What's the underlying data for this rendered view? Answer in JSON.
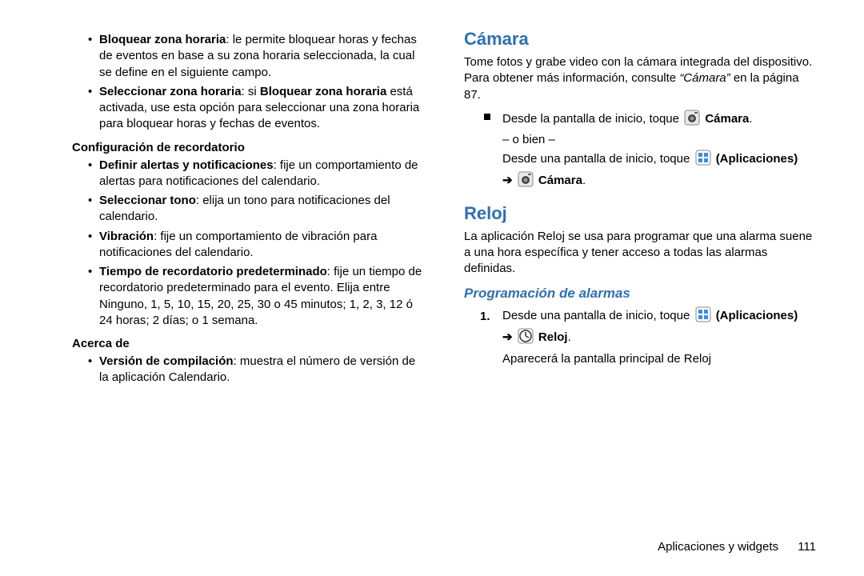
{
  "left": {
    "b1_label": "Bloquear zona horaria",
    "b1_text": ": le permite bloquear horas y fechas de eventos en base a su zona horaria seleccionada, la cual se define en el siguiente campo.",
    "b2_label": "Seleccionar zona horaria",
    "b2_text_a": ": si ",
    "b2_bold": "Bloquear zona horaria",
    "b2_text_b": " está activada, use esta opción para seleccionar una zona horaria para bloquear horas y fechas de eventos.",
    "sub1": "Configuración de recordatorio",
    "b3_label": "Definir alertas y notificaciones",
    "b3_text": ": fije un comportamiento de alertas para notificaciones del calendario.",
    "b4_label": "Seleccionar tono",
    "b4_text": ": elija un tono para notificaciones del calendario.",
    "b5_label": "Vibración",
    "b5_text": ": fije un comportamiento de vibración para notificaciones del calendario.",
    "b6_label": "Tiempo de recordatorio predeterminado",
    "b6_text": ": fije un tiempo de recordatorio predeterminado para el evento. Elija entre Ninguno, 1, 5, 10, 15, 20, 25, 30 o 45 minutos; 1, 2, 3, 12 ó 24 horas; 2 días; o 1 semana.",
    "sub2": "Acerca de",
    "b7_label": "Versión de compilación",
    "b7_text": ": muestra el número de versión de la aplicación Calendario."
  },
  "right": {
    "h_camara": "Cámara",
    "camara_intro_a": "Tome fotos y grabe video con la cámara integrada del dispositivo. Para obtener más información, consulte ",
    "camara_intro_ref": "“Cámara”",
    "camara_intro_b": " en la página 87.",
    "step_cam_a": "Desde la pantalla de inicio, toque ",
    "camara_label": "Cámara",
    "step_cam_or": "– o bien –",
    "step_cam_b": "Desde una pantalla de inicio, toque ",
    "apps_label": "(Aplicaciones)",
    "arrow": "➔",
    "h_reloj": "Reloj",
    "reloj_intro": "La aplicación Reloj se usa para programar que una alarma suene a una hora específica y tener acceso a todas las alarmas definidas.",
    "sub_prog": "Programación de alarmas",
    "step1_num": "1.",
    "step1_a": "Desde una pantalla de inicio, toque ",
    "reloj_label": "Reloj",
    "step1_result": "Aparecerá la pantalla principal de Reloj"
  },
  "footer": {
    "section": "Aplicaciones y widgets",
    "page": "111"
  }
}
